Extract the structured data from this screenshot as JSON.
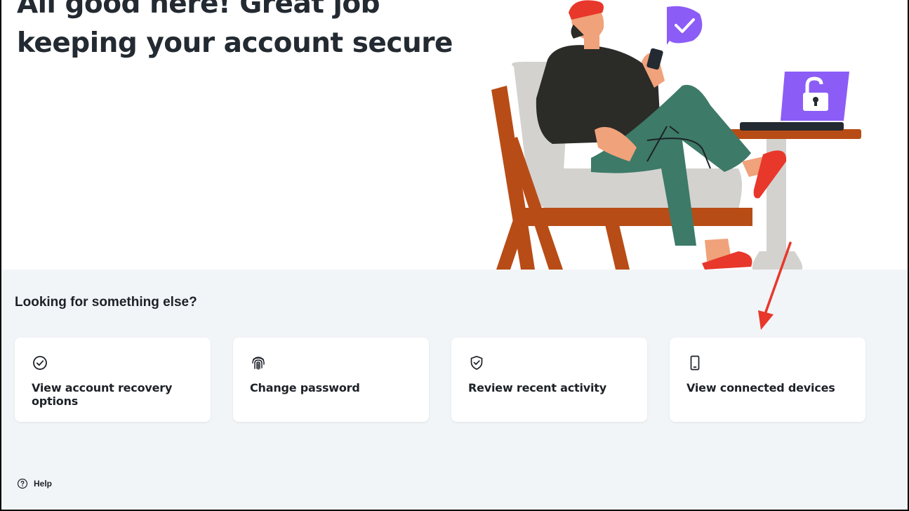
{
  "hero": {
    "title": "All good here! Great job keeping your account secure"
  },
  "section": {
    "heading": "Looking for something else?"
  },
  "cards": [
    {
      "label": "View account recovery options",
      "icon": "check-circle-icon"
    },
    {
      "label": "Change password",
      "icon": "fingerprint-icon"
    },
    {
      "label": "Review recent activity",
      "icon": "shield-check-icon"
    },
    {
      "label": "View connected devices",
      "icon": "phone-device-icon"
    }
  ],
  "footer": {
    "help_label": "Help",
    "help_icon": "question-circle-icon"
  },
  "colors": {
    "accent_purple": "#8c5cf6",
    "annotation_red": "#e8372b",
    "chair_wood": "#b84c16",
    "lower_background": "#f2f5f8"
  }
}
